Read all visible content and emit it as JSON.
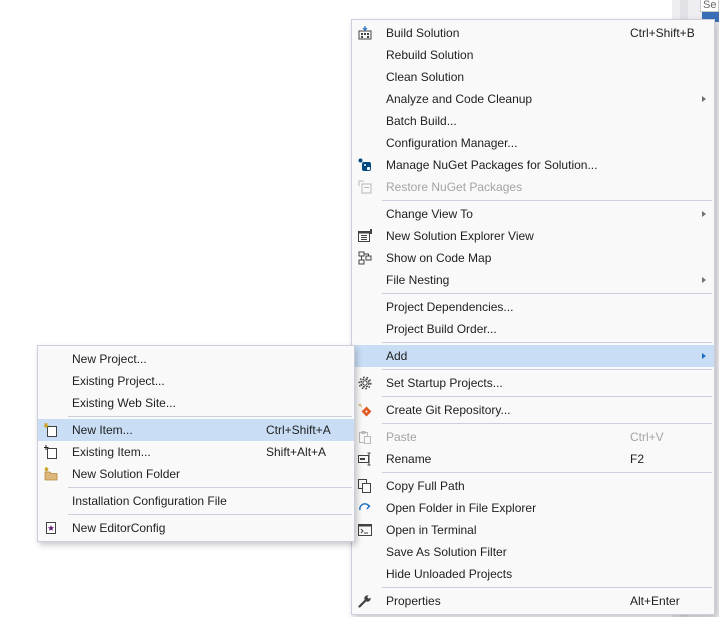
{
  "colors": {
    "menu_bg": "#f9f9f9",
    "highlight": "#c9def5",
    "border": "#cccedb",
    "disabled_text": "#a2a4a5",
    "accent_blue": "#1e6fc4",
    "nuget_blue": "#004880",
    "git_orange": "#e05a24",
    "folder_yellow": "#dcb67a"
  },
  "background": {
    "search_text": "Se"
  },
  "context_menu": {
    "build_solution": {
      "label": "Build Solution",
      "shortcut": "Ctrl+Shift+B",
      "icon": "build-icon"
    },
    "rebuild_solution": {
      "label": "Rebuild Solution"
    },
    "clean_solution": {
      "label": "Clean Solution"
    },
    "analyze": {
      "label": "Analyze and Code Cleanup"
    },
    "batch_build": {
      "label": "Batch Build..."
    },
    "config_manager": {
      "label": "Configuration Manager..."
    },
    "manage_nuget": {
      "label": "Manage NuGet Packages for Solution...",
      "icon": "nuget-icon"
    },
    "restore_nuget": {
      "label": "Restore NuGet Packages",
      "icon": "restore-packages-icon"
    },
    "change_view": {
      "label": "Change View To"
    },
    "new_solution_explorer_view": {
      "label": "New Solution Explorer View",
      "icon": "new-view-icon"
    },
    "show_code_map": {
      "label": "Show on Code Map",
      "icon": "code-map-icon"
    },
    "file_nesting": {
      "label": "File Nesting"
    },
    "project_dependencies": {
      "label": "Project Dependencies..."
    },
    "project_build_order": {
      "label": "Project Build Order..."
    },
    "add": {
      "label": "Add"
    },
    "set_startup_projects": {
      "label": "Set Startup Projects...",
      "icon": "gear-icon"
    },
    "create_git_repo": {
      "label": "Create Git Repository...",
      "icon": "git-icon"
    },
    "paste": {
      "label": "Paste",
      "shortcut": "Ctrl+V",
      "icon": "paste-icon"
    },
    "rename": {
      "label": "Rename",
      "shortcut": "F2",
      "icon": "rename-icon"
    },
    "copy_full_path": {
      "label": "Copy Full Path",
      "icon": "copy-icon"
    },
    "open_folder": {
      "label": "Open Folder in File Explorer",
      "icon": "open-folder-icon"
    },
    "open_terminal": {
      "label": "Open in Terminal",
      "icon": "terminal-icon"
    },
    "save_as_filter": {
      "label": "Save As Solution Filter"
    },
    "hide_unloaded": {
      "label": "Hide Unloaded Projects"
    },
    "properties": {
      "label": "Properties",
      "shortcut": "Alt+Enter",
      "icon": "wrench-icon"
    }
  },
  "add_submenu": {
    "new_project": {
      "label": "New Project..."
    },
    "existing_project": {
      "label": "Existing Project..."
    },
    "existing_web_site": {
      "label": "Existing Web Site..."
    },
    "new_item": {
      "label": "New Item...",
      "shortcut": "Ctrl+Shift+A",
      "icon": "new-item-icon"
    },
    "existing_item": {
      "label": "Existing Item...",
      "shortcut": "Shift+Alt+A",
      "icon": "existing-item-icon"
    },
    "new_solution_folder": {
      "label": "New Solution Folder",
      "icon": "new-folder-icon"
    },
    "installation_config": {
      "label": "Installation Configuration File"
    },
    "new_editorconfig": {
      "label": "New EditorConfig",
      "icon": "editorconfig-icon"
    }
  }
}
